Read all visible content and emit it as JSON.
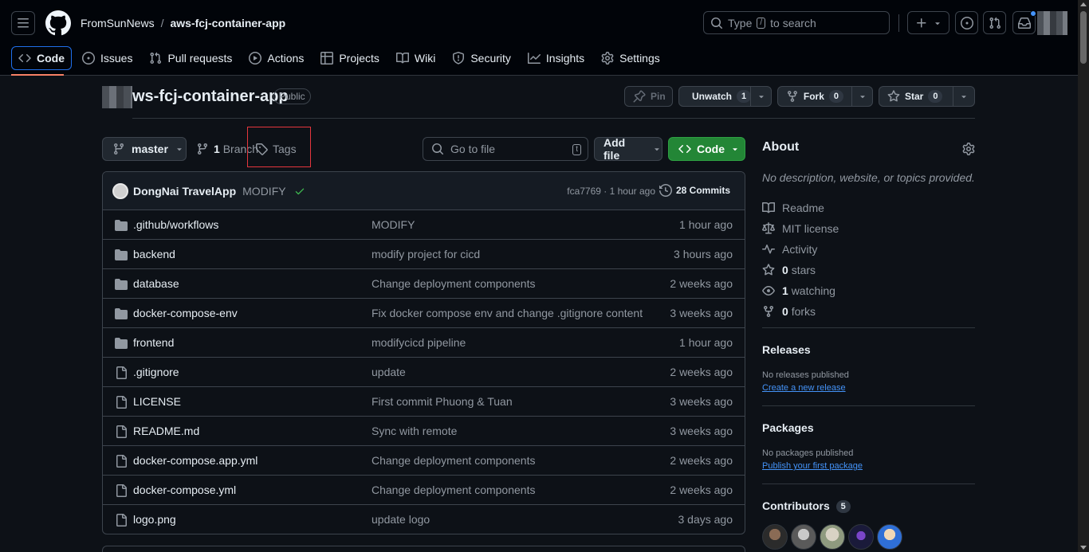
{
  "header": {
    "owner": "FromSunNews",
    "separator": "/",
    "repo": "aws-fcj-container-app",
    "search_prefix": "Type",
    "search_key": "/",
    "search_suffix": "to search"
  },
  "nav": {
    "tabs": [
      {
        "label": "Code",
        "icon": "code-icon",
        "active": true
      },
      {
        "label": "Issues",
        "icon": "issue-opened-icon"
      },
      {
        "label": "Pull requests",
        "icon": "git-pull-request-icon"
      },
      {
        "label": "Actions",
        "icon": "play-icon"
      },
      {
        "label": "Projects",
        "icon": "table-icon"
      },
      {
        "label": "Wiki",
        "icon": "book-icon"
      },
      {
        "label": "Security",
        "icon": "shield-icon"
      },
      {
        "label": "Insights",
        "icon": "graph-icon"
      },
      {
        "label": "Settings",
        "icon": "gear-icon"
      }
    ]
  },
  "repo_head": {
    "name": "ws-fcj-container-app",
    "visibility": "Public",
    "pin_label": "Pin",
    "unwatch_label": "Unwatch",
    "unwatch_count": "1",
    "fork_label": "Fork",
    "fork_count": "0",
    "star_label": "Star",
    "star_count": "0"
  },
  "toolbar": {
    "branch": "master",
    "branch_count": "1",
    "branch_label": "Branch",
    "tags_label": "Tags",
    "goto_placeholder": "Go to file",
    "goto_key": "t",
    "add_file_label": "Add file",
    "code_label": "Code"
  },
  "commit": {
    "author": "DongNai TravelApp",
    "message": "MODIFY",
    "meta": "fca7769 · 1 hour ago",
    "count_label": "28 Commits"
  },
  "files": [
    {
      "type": "dir",
      "name": ".github/workflows",
      "message": "MODIFY",
      "time": "1 hour ago"
    },
    {
      "type": "dir",
      "name": "backend",
      "message": "modify project for cicd",
      "time": "3 hours ago"
    },
    {
      "type": "dir",
      "name": "database",
      "message": "Change deployment components",
      "time": "2 weeks ago"
    },
    {
      "type": "dir",
      "name": "docker-compose-env",
      "message": "Fix docker compose env and change .gitignore content",
      "time": "3 weeks ago"
    },
    {
      "type": "dir",
      "name": "frontend",
      "message": "modifycicd pipeline",
      "time": "1 hour ago"
    },
    {
      "type": "file",
      "name": ".gitignore",
      "message": "update",
      "time": "2 weeks ago"
    },
    {
      "type": "file",
      "name": "LICENSE",
      "message": "First commit Phuong & Tuan",
      "time": "3 weeks ago"
    },
    {
      "type": "file",
      "name": "README.md",
      "message": "Sync with remote",
      "time": "3 weeks ago"
    },
    {
      "type": "file",
      "name": "docker-compose.app.yml",
      "message": "Change deployment components",
      "time": "2 weeks ago"
    },
    {
      "type": "file",
      "name": "docker-compose.yml",
      "message": "Change deployment components",
      "time": "2 weeks ago"
    },
    {
      "type": "file",
      "name": "logo.png",
      "message": "update logo",
      "time": "3 days ago"
    }
  ],
  "about": {
    "title": "About",
    "description": "No description, website, or topics provided.",
    "readme": "Readme",
    "license": "MIT license",
    "activity": "Activity",
    "stars_count": "0",
    "stars_label": "stars",
    "watching_count": "1",
    "watching_label": "watching",
    "forks_count": "0",
    "forks_label": "forks"
  },
  "releases": {
    "title": "Releases",
    "empty": "No releases published",
    "link": "Create a new release"
  },
  "packages": {
    "title": "Packages",
    "empty": "No packages published",
    "link": "Publish your first package"
  },
  "contributors": {
    "title": "Contributors",
    "count": "5"
  },
  "colors": {
    "accent": "#1f6feb",
    "primary_button": "#238636",
    "link": "#4493f8",
    "highlight_box": "#e5363d"
  }
}
